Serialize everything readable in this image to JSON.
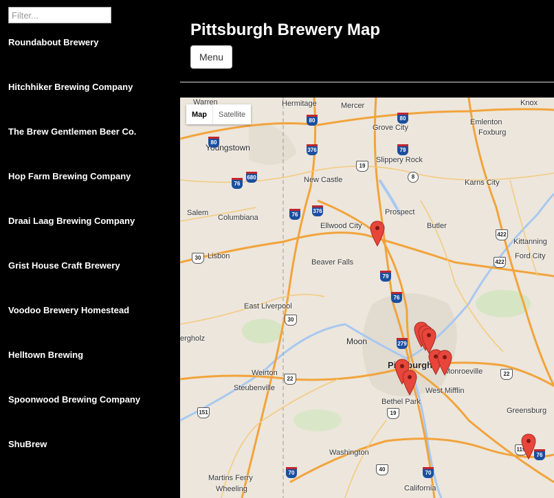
{
  "sidebar": {
    "filter_placeholder": "Filter...",
    "breweries": [
      "Roundabout Brewery",
      "Hitchhiker Brewing Company",
      "The Brew Gentlemen Beer Co.",
      "Hop Farm Brewing Company",
      "Draai Laag Brewing Company",
      "Grist House Craft Brewery",
      "Voodoo Brewery Homestead",
      "Helltown Brewing",
      "Spoonwood Brewing Company",
      "ShuBrew"
    ]
  },
  "header": {
    "title": "Pittsburgh Brewery Map",
    "menu_label": "Menu"
  },
  "map": {
    "type_control": {
      "map_label": "Map",
      "satellite_label": "Satellite",
      "active": "Map"
    },
    "places": [
      "Warren",
      "Hermitage",
      "Mercer",
      "Knox",
      "Grove City",
      "Emlenton",
      "Foxburg",
      "Youngstown",
      "Slippery Rock",
      "New Castle",
      "Karns City",
      "Prospect",
      "Salem",
      "Columbiana",
      "Ellwood City",
      "Butler",
      "Kittanning",
      "Lisbon",
      "Beaver Falls",
      "Ford City",
      "East Liverpool",
      "Moon",
      "Weirton",
      "Pittsburgh",
      "Monroeville",
      "Steubenville",
      "West Mifflin",
      "Bethel Park",
      "Greensburg",
      "Washington",
      "Martins Ferry",
      "Wheeling",
      "California",
      "ergholz"
    ],
    "shields": [
      "80",
      "80",
      "80",
      "376",
      "79",
      "19",
      "8",
      "680",
      "76",
      "422",
      "76",
      "376",
      "30",
      "422",
      "79",
      "76",
      "30",
      "279",
      "22",
      "19",
      "22",
      "151",
      "70",
      "119",
      "76",
      "70",
      "40"
    ],
    "marker_pins": 10,
    "colors": {
      "marker": "#e8463b",
      "highway": "#f2a33a",
      "water": "#a7c8f0",
      "land": "#ece6dc"
    }
  }
}
